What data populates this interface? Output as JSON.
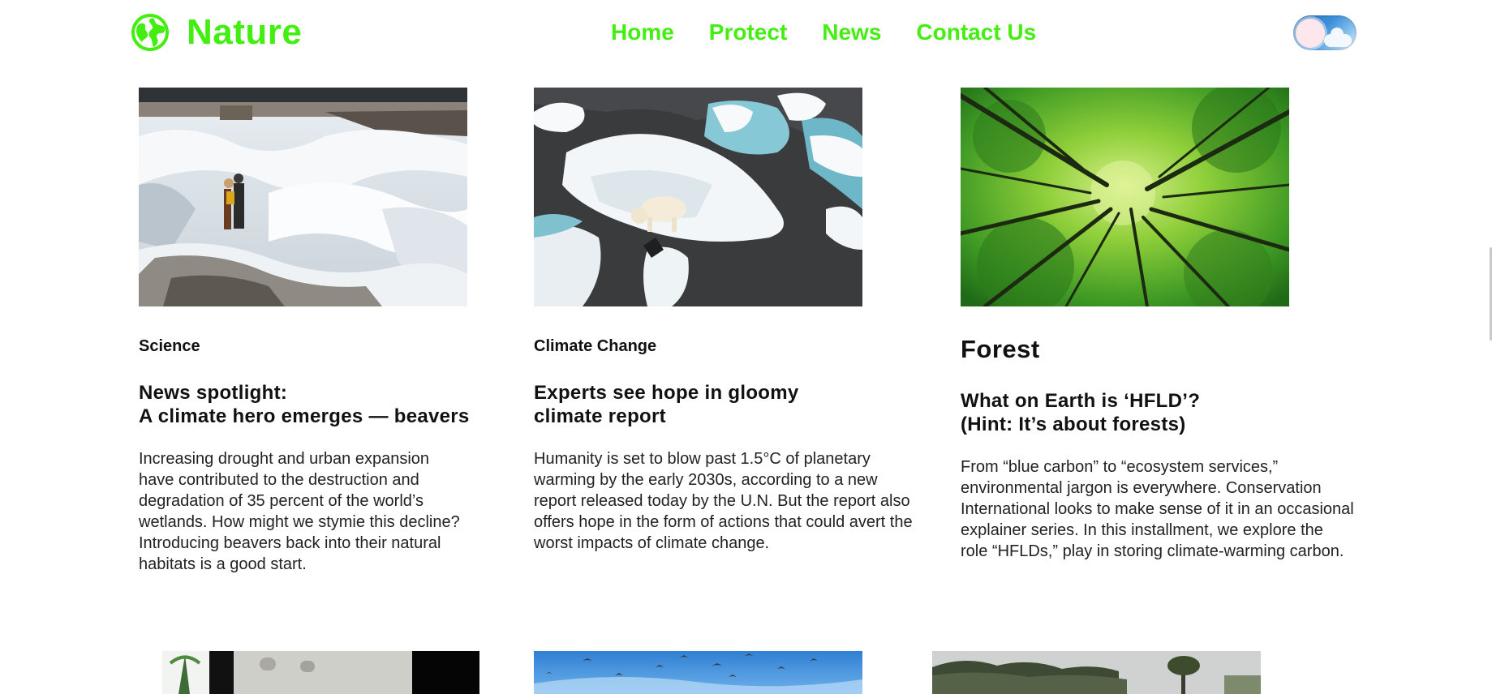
{
  "header": {
    "logo_text": "Nature",
    "logo_icon": "globe-icon",
    "nav": [
      "Home",
      "Protect",
      "News",
      "Contact Us"
    ],
    "toggle_icon": "day-night-toggle"
  },
  "colors": {
    "brand": "#44ee11",
    "text": "#111111"
  },
  "cards": [
    {
      "category": "Science",
      "title": "News spotlight:\nA climate hero emerges — beavers",
      "body": "Increasing drought and urban expansion have contributed to the destruction and degradation of 35 percent of the world’s wetlands. How might we stymie this decline? Introducing beavers back into their natural habitats is a good start."
    },
    {
      "category": "Climate Change",
      "title": "Experts see hope in gloomy\nclimate report",
      "body": "Humanity is set to blow past 1.5°C of planetary warming by the early 2030s, according to a new report released today by the U.N. But the report also offers hope in the form of actions that could avert the worst impacts of climate change."
    },
    {
      "category": "Forest",
      "title": "What on Earth is ‘HFLD’?\n(Hint: It’s about forests)",
      "body": "From “blue carbon” to “ecosystem services,” environmental jargon is everywhere. Conservation International looks to make sense of it in an occasional explainer series. In this installment, we explore the role “HFLDs,” play in storing climate-warming carbon."
    }
  ]
}
